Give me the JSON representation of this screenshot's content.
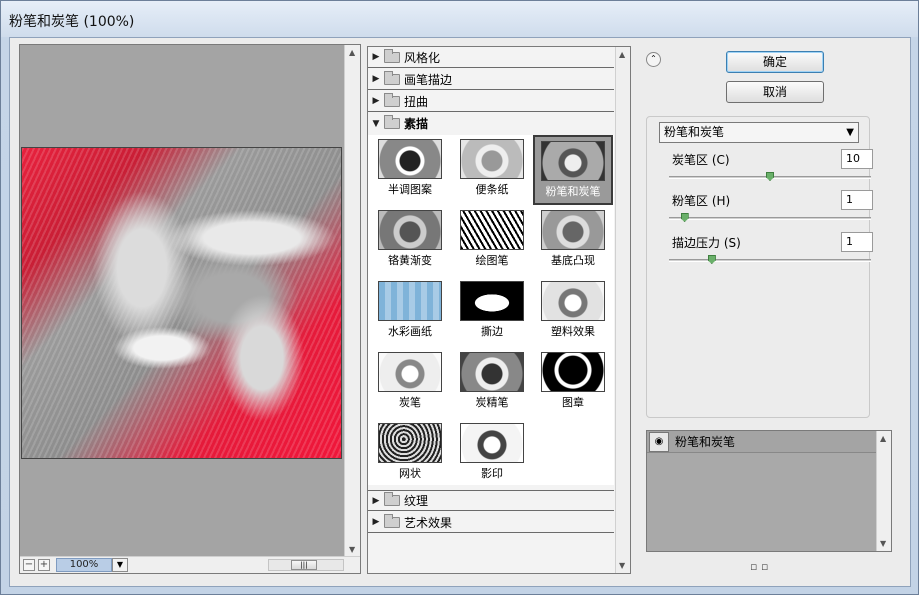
{
  "window": {
    "title": "粉笔和炭笔 (100%)"
  },
  "preview": {
    "zoom": "100%",
    "zoom_out": "−",
    "zoom_in": "+"
  },
  "gallery": {
    "categories_top": [
      {
        "label": "风格化"
      },
      {
        "label": "画笔描边"
      },
      {
        "label": "扭曲"
      }
    ],
    "open_category": {
      "label": "素描"
    },
    "thumbnails": [
      {
        "label": "半调图案"
      },
      {
        "label": "便条纸"
      },
      {
        "label": "粉笔和炭笔",
        "selected": true
      },
      {
        "label": "铬黄渐变"
      },
      {
        "label": "绘图笔"
      },
      {
        "label": "基底凸现"
      },
      {
        "label": "水彩画纸"
      },
      {
        "label": "撕边"
      },
      {
        "label": "塑料效果"
      },
      {
        "label": "炭笔"
      },
      {
        "label": "炭精笔"
      },
      {
        "label": "图章"
      },
      {
        "label": "网状"
      },
      {
        "label": "影印"
      }
    ],
    "categories_bottom": [
      {
        "label": "纹理"
      },
      {
        "label": "艺术效果"
      }
    ]
  },
  "buttons": {
    "ok": "确定",
    "cancel": "取消"
  },
  "filter_select": {
    "value": "粉笔和炭笔"
  },
  "params": [
    {
      "label": "炭笔区 (C)",
      "value": "10",
      "level": 0.5
    },
    {
      "label": "粉笔区 (H)",
      "value": "1",
      "level": 0.06
    },
    {
      "label": "描边压力 (S)",
      "value": "1",
      "level": 0.2
    }
  ],
  "layers": {
    "row_label": "粉笔和炭笔"
  },
  "colors": {
    "selected_button_border": "#3c7fb1",
    "preview_bg": "#a4a4a4",
    "image_red": "#e8213d"
  },
  "icons": {
    "collapse": "double-chevron-up-icon",
    "eye": "eye-icon",
    "folder": "folder-icon"
  }
}
